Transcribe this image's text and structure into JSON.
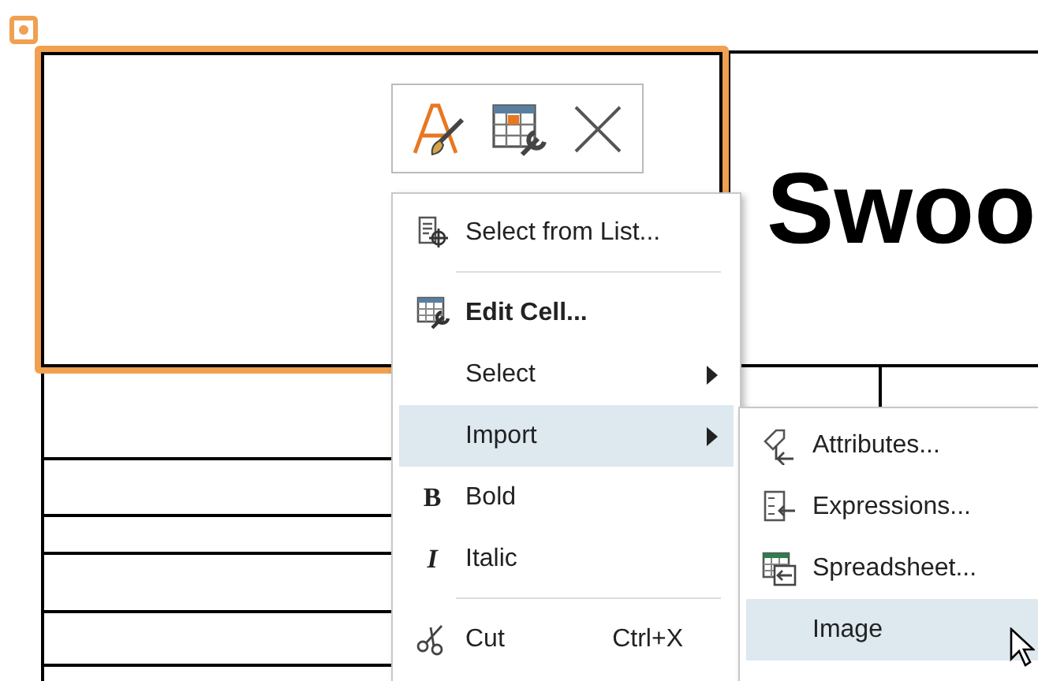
{
  "drawing": {
    "title_text": "Swoo"
  },
  "context_menu": {
    "items": [
      {
        "kind": "item",
        "label": "Select from List...",
        "selected": false,
        "submenu": false
      },
      {
        "kind": "separator"
      },
      {
        "kind": "item",
        "label": "Edit Cell...",
        "selected": false,
        "submenu": false,
        "bold": true
      },
      {
        "kind": "item",
        "label": "Select",
        "selected": false,
        "submenu": true
      },
      {
        "kind": "item",
        "label": "Import",
        "selected": true,
        "submenu": true
      },
      {
        "kind": "item",
        "label": "Bold",
        "glyph": "B",
        "selected": false,
        "submenu": false
      },
      {
        "kind": "item",
        "label": "Italic",
        "glyph": "I",
        "selected": false,
        "submenu": false
      },
      {
        "kind": "separator"
      },
      {
        "kind": "item",
        "label": "Cut",
        "shortcut": "Ctrl+X",
        "selected": false,
        "submenu": false
      }
    ]
  },
  "import_submenu": {
    "items": [
      {
        "label": "Attributes...",
        "selected": false
      },
      {
        "label": "Expressions...",
        "selected": false
      },
      {
        "label": "Spreadsheet...",
        "selected": false
      },
      {
        "label": "Image",
        "selected": true
      }
    ]
  }
}
